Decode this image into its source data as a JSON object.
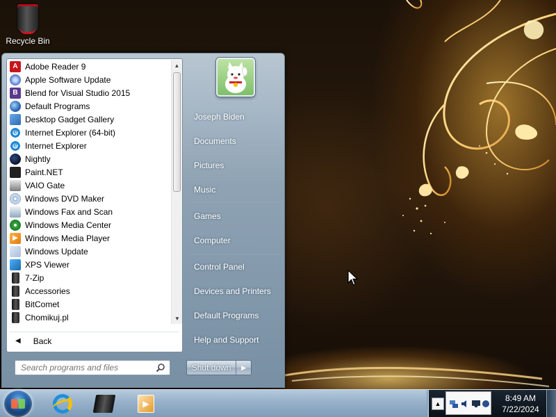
{
  "desktop": {
    "recycle_bin_label": "Recycle Bin"
  },
  "start_menu": {
    "programs": [
      {
        "label": "Adobe Reader 9",
        "icon": "adobe-reader-icon",
        "glyph": "A",
        "cls": "ico-pdf"
      },
      {
        "label": "Apple Software Update",
        "icon": "apple-update-icon",
        "glyph": "",
        "cls": "ico-apple"
      },
      {
        "label": "Blend for Visual Studio 2015",
        "icon": "blend-icon",
        "glyph": "B",
        "cls": "ico-blend"
      },
      {
        "label": "Default Programs",
        "icon": "default-programs-icon",
        "glyph": "",
        "cls": "ico-default"
      },
      {
        "label": "Desktop Gadget Gallery",
        "icon": "gadget-gallery-icon",
        "glyph": "",
        "cls": "ico-gadget"
      },
      {
        "label": "Internet Explorer (64-bit)",
        "icon": "internet-explorer-icon",
        "glyph": "e",
        "cls": "ico-ie"
      },
      {
        "label": "Internet Explorer",
        "icon": "internet-explorer-icon",
        "glyph": "e",
        "cls": "ico-ie"
      },
      {
        "label": "Nightly",
        "icon": "nightly-icon",
        "glyph": "",
        "cls": "ico-nightly"
      },
      {
        "label": "Paint.NET",
        "icon": "paint-net-icon",
        "glyph": "",
        "cls": "ico-paint"
      },
      {
        "label": "VAIO Gate",
        "icon": "vaio-gate-icon",
        "glyph": "",
        "cls": "ico-vaio"
      },
      {
        "label": "Windows DVD Maker",
        "icon": "dvd-maker-icon",
        "glyph": "",
        "cls": "ico-dvd"
      },
      {
        "label": "Windows Fax and Scan",
        "icon": "fax-scan-icon",
        "glyph": "",
        "cls": "ico-fax"
      },
      {
        "label": "Windows Media Center",
        "icon": "media-center-icon",
        "glyph": "",
        "cls": "ico-wmc"
      },
      {
        "label": "Windows Media Player",
        "icon": "media-player-icon",
        "glyph": "▶",
        "cls": "ico-wmp"
      },
      {
        "label": "Windows Update",
        "icon": "windows-update-icon",
        "glyph": "",
        "cls": "ico-wu"
      },
      {
        "label": "XPS Viewer",
        "icon": "xps-viewer-icon",
        "glyph": "",
        "cls": "ico-xps"
      },
      {
        "label": "7-Zip",
        "icon": "folder-icon",
        "glyph": "",
        "cls": "ico-folder"
      },
      {
        "label": "Accessories",
        "icon": "folder-icon",
        "glyph": "",
        "cls": "ico-folder"
      },
      {
        "label": "BitComet",
        "icon": "folder-icon",
        "glyph": "",
        "cls": "ico-folder"
      },
      {
        "label": "Chomikuj.pl",
        "icon": "folder-icon",
        "glyph": "",
        "cls": "ico-folder"
      }
    ],
    "back_label": "Back",
    "search_placeholder": "Search programs and files",
    "user_name": "Joseph Biden",
    "right_items": {
      "documents": "Documents",
      "pictures": "Pictures",
      "music": "Music",
      "games": "Games",
      "computer": "Computer",
      "control_panel": "Control Panel",
      "devices_printers": "Devices and Printers",
      "default_programs": "Default Programs",
      "help_support": "Help and Support"
    },
    "shutdown_label": "Shut down"
  },
  "taskbar": {
    "pinned": [
      "internet-explorer-icon",
      "folder-icon",
      "media-player-icon"
    ],
    "clock_time": "8:49 AM",
    "clock_date": "7/22/2024"
  }
}
